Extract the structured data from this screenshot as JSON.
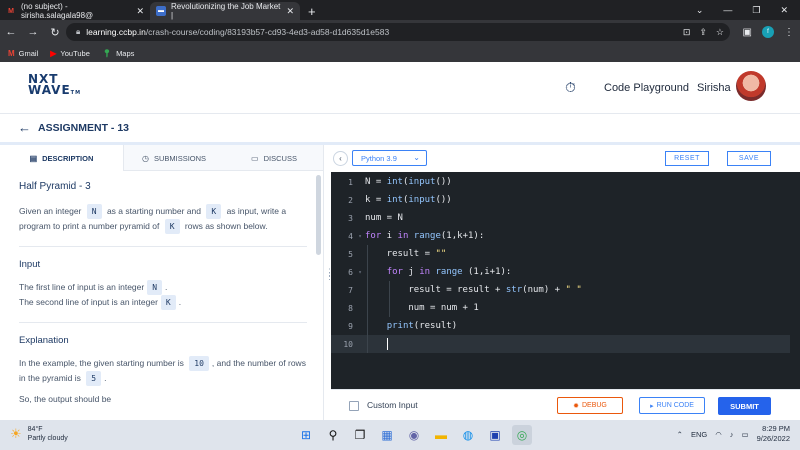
{
  "browser": {
    "tabs": [
      {
        "title": "(no subject) - sirisha.salagala98@",
        "icon": "gmail-icon"
      },
      {
        "title": "Revolutionizing the Job Market |",
        "icon": "ccbp-icon"
      }
    ],
    "url_host": "learning.ccbp.in",
    "url_path": "/crash-course/coding/83193b57-cd93-4ed3-ad58-d1d635d1e583",
    "profile_initial": "f",
    "bookmarks": [
      {
        "label": "Gmail",
        "icon": "gmail-icon"
      },
      {
        "label": "YouTube",
        "icon": "youtube-icon"
      },
      {
        "label": "Maps",
        "icon": "maps-icon"
      }
    ]
  },
  "header": {
    "logo_line1": "NXT",
    "logo_line2": "WAVE",
    "logo_tm": "TM",
    "playground_label": "Code Playground",
    "user_name": "Sirisha"
  },
  "assignment": {
    "title": "ASSIGNMENT - 13"
  },
  "left_panel": {
    "tabs": [
      "DESCRIPTION",
      "SUBMISSIONS",
      "DISCUSS"
    ],
    "problem_title": "Half Pyramid - 3",
    "desc_part1": "Given an integer",
    "var_n": "N",
    "desc_part2": "as a starting number and",
    "var_k": "K",
    "desc_part3": "as input, write a program to print a number pyramid of",
    "desc_part4": "rows as shown below.",
    "input_heading": "Input",
    "input_line1": "The first line of input is an integer",
    "input_line2": "The second line of input is an integer",
    "explanation_heading": "Explanation",
    "expl_part1": "In the example, the given starting number is",
    "expl_num1": "10",
    "expl_part2": ", and the number of rows in the pyramid is",
    "expl_num2": "5",
    "expl_cut": "So, the output should be"
  },
  "editor": {
    "language": "Python 3.9",
    "reset_label": "RESET",
    "save_label": "SAVE",
    "line_numbers": [
      "1",
      "2",
      "3",
      "4",
      "5",
      "6",
      "7",
      "8",
      "9",
      "10"
    ]
  },
  "actions": {
    "custom_input_label": "Custom Input",
    "debug_label": "DEBUG",
    "run_label": "RUN CODE",
    "submit_label": "SUBMIT"
  },
  "taskbar": {
    "temperature": "84°F",
    "weather_desc": "Partly cloudy",
    "lang": "ENG",
    "time": "8:29 PM",
    "date": "9/26/2022"
  }
}
